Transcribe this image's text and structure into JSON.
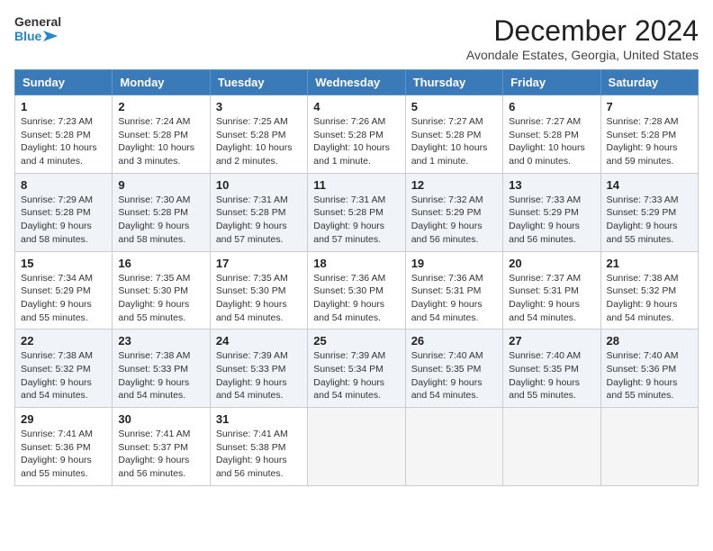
{
  "header": {
    "logo_line1": "General",
    "logo_line2": "Blue",
    "month_title": "December 2024",
    "location": "Avondale Estates, Georgia, United States"
  },
  "weekdays": [
    "Sunday",
    "Monday",
    "Tuesday",
    "Wednesday",
    "Thursday",
    "Friday",
    "Saturday"
  ],
  "weeks": [
    [
      {
        "day": "1",
        "sunrise": "7:23 AM",
        "sunset": "5:28 PM",
        "daylight": "10 hours and 4 minutes."
      },
      {
        "day": "2",
        "sunrise": "7:24 AM",
        "sunset": "5:28 PM",
        "daylight": "10 hours and 3 minutes."
      },
      {
        "day": "3",
        "sunrise": "7:25 AM",
        "sunset": "5:28 PM",
        "daylight": "10 hours and 2 minutes."
      },
      {
        "day": "4",
        "sunrise": "7:26 AM",
        "sunset": "5:28 PM",
        "daylight": "10 hours and 1 minute."
      },
      {
        "day": "5",
        "sunrise": "7:27 AM",
        "sunset": "5:28 PM",
        "daylight": "10 hours and 1 minute."
      },
      {
        "day": "6",
        "sunrise": "7:27 AM",
        "sunset": "5:28 PM",
        "daylight": "10 hours and 0 minutes."
      },
      {
        "day": "7",
        "sunrise": "7:28 AM",
        "sunset": "5:28 PM",
        "daylight": "9 hours and 59 minutes."
      }
    ],
    [
      {
        "day": "8",
        "sunrise": "7:29 AM",
        "sunset": "5:28 PM",
        "daylight": "9 hours and 58 minutes."
      },
      {
        "day": "9",
        "sunrise": "7:30 AM",
        "sunset": "5:28 PM",
        "daylight": "9 hours and 58 minutes."
      },
      {
        "day": "10",
        "sunrise": "7:31 AM",
        "sunset": "5:28 PM",
        "daylight": "9 hours and 57 minutes."
      },
      {
        "day": "11",
        "sunrise": "7:31 AM",
        "sunset": "5:28 PM",
        "daylight": "9 hours and 57 minutes."
      },
      {
        "day": "12",
        "sunrise": "7:32 AM",
        "sunset": "5:29 PM",
        "daylight": "9 hours and 56 minutes."
      },
      {
        "day": "13",
        "sunrise": "7:33 AM",
        "sunset": "5:29 PM",
        "daylight": "9 hours and 56 minutes."
      },
      {
        "day": "14",
        "sunrise": "7:33 AM",
        "sunset": "5:29 PM",
        "daylight": "9 hours and 55 minutes."
      }
    ],
    [
      {
        "day": "15",
        "sunrise": "7:34 AM",
        "sunset": "5:29 PM",
        "daylight": "9 hours and 55 minutes."
      },
      {
        "day": "16",
        "sunrise": "7:35 AM",
        "sunset": "5:30 PM",
        "daylight": "9 hours and 55 minutes."
      },
      {
        "day": "17",
        "sunrise": "7:35 AM",
        "sunset": "5:30 PM",
        "daylight": "9 hours and 54 minutes."
      },
      {
        "day": "18",
        "sunrise": "7:36 AM",
        "sunset": "5:30 PM",
        "daylight": "9 hours and 54 minutes."
      },
      {
        "day": "19",
        "sunrise": "7:36 AM",
        "sunset": "5:31 PM",
        "daylight": "9 hours and 54 minutes."
      },
      {
        "day": "20",
        "sunrise": "7:37 AM",
        "sunset": "5:31 PM",
        "daylight": "9 hours and 54 minutes."
      },
      {
        "day": "21",
        "sunrise": "7:38 AM",
        "sunset": "5:32 PM",
        "daylight": "9 hours and 54 minutes."
      }
    ],
    [
      {
        "day": "22",
        "sunrise": "7:38 AM",
        "sunset": "5:32 PM",
        "daylight": "9 hours and 54 minutes."
      },
      {
        "day": "23",
        "sunrise": "7:38 AM",
        "sunset": "5:33 PM",
        "daylight": "9 hours and 54 minutes."
      },
      {
        "day": "24",
        "sunrise": "7:39 AM",
        "sunset": "5:33 PM",
        "daylight": "9 hours and 54 minutes."
      },
      {
        "day": "25",
        "sunrise": "7:39 AM",
        "sunset": "5:34 PM",
        "daylight": "9 hours and 54 minutes."
      },
      {
        "day": "26",
        "sunrise": "7:40 AM",
        "sunset": "5:35 PM",
        "daylight": "9 hours and 54 minutes."
      },
      {
        "day": "27",
        "sunrise": "7:40 AM",
        "sunset": "5:35 PM",
        "daylight": "9 hours and 55 minutes."
      },
      {
        "day": "28",
        "sunrise": "7:40 AM",
        "sunset": "5:36 PM",
        "daylight": "9 hours and 55 minutes."
      }
    ],
    [
      {
        "day": "29",
        "sunrise": "7:41 AM",
        "sunset": "5:36 PM",
        "daylight": "9 hours and 55 minutes."
      },
      {
        "day": "30",
        "sunrise": "7:41 AM",
        "sunset": "5:37 PM",
        "daylight": "9 hours and 56 minutes."
      },
      {
        "day": "31",
        "sunrise": "7:41 AM",
        "sunset": "5:38 PM",
        "daylight": "9 hours and 56 minutes."
      },
      null,
      null,
      null,
      null
    ]
  ],
  "labels": {
    "sunrise": "Sunrise:",
    "sunset": "Sunset:",
    "daylight": "Daylight hours"
  }
}
